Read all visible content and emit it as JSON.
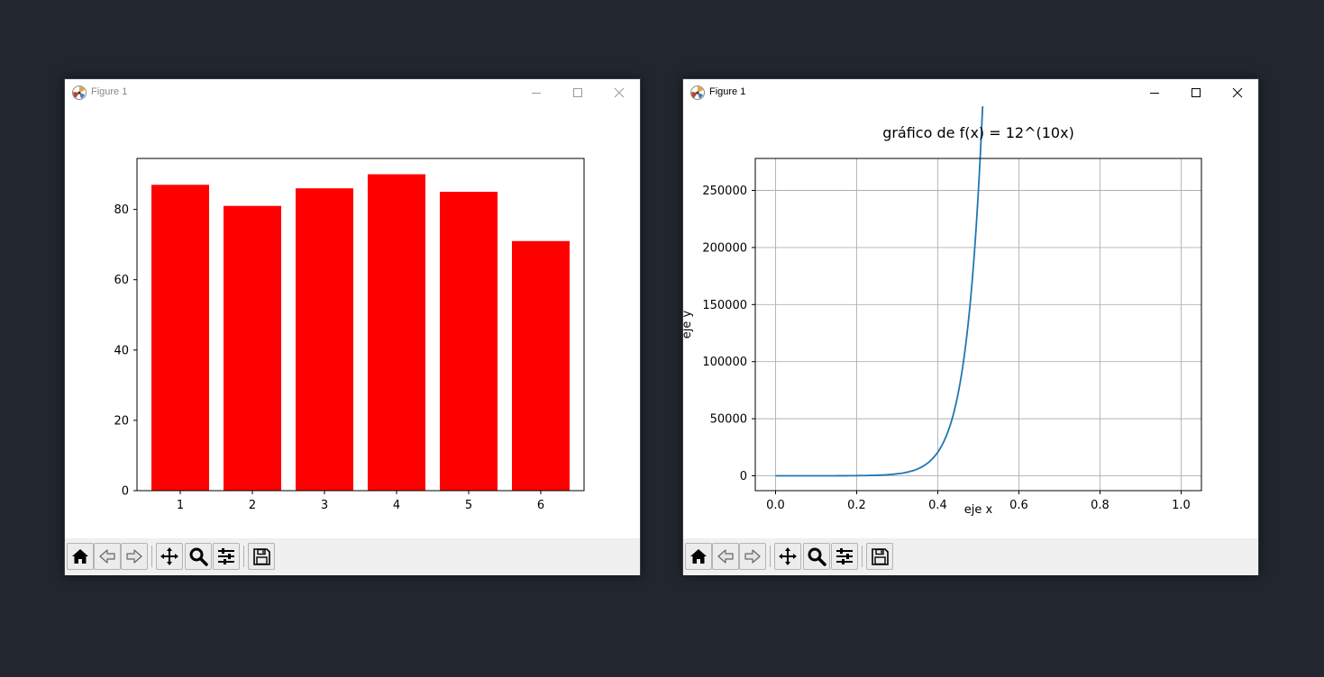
{
  "windows": [
    {
      "title": "Figure 1",
      "active": false
    },
    {
      "title": "Figure 1",
      "active": true
    }
  ],
  "toolbar_icons": [
    "home-icon",
    "back-icon",
    "forward-icon",
    "pan-icon",
    "zoom-icon",
    "configure-icon",
    "save-icon"
  ],
  "colors": {
    "desktop": "#22262e",
    "bar": "#ff0000",
    "line": "#1f77b4",
    "grid": "#b0b0b0",
    "toolbar": "#f0f0f0"
  },
  "chart_data": [
    {
      "type": "bar",
      "title": "",
      "xlabel": "",
      "ylabel": "",
      "categories": [
        "1",
        "2",
        "3",
        "4",
        "5",
        "6"
      ],
      "values": [
        87,
        81,
        86,
        90,
        85,
        71
      ],
      "ylim": [
        0,
        94.5
      ],
      "yticks": [
        0,
        20,
        40,
        60,
        80
      ],
      "ytick_labels": [
        "0",
        "20",
        "40",
        "60",
        "80"
      ],
      "grid": false
    },
    {
      "type": "line",
      "title": "gráfico de f(x) = 12^(10x)",
      "xlabel": "eje x",
      "ylabel": "eje y",
      "function": "12^(10x)",
      "x_range": [
        0,
        1
      ],
      "xlim": [
        -0.05,
        1.05
      ],
      "ylim": [
        -13000,
        278000
      ],
      "xticks": [
        0.0,
        0.2,
        0.4,
        0.6,
        0.8,
        1.0
      ],
      "xtick_labels": [
        "0.0",
        "0.2",
        "0.4",
        "0.6",
        "0.8",
        "1.0"
      ],
      "yticks": [
        0,
        50000,
        100000,
        150000,
        200000,
        250000
      ],
      "ytick_labels": [
        "0",
        "50000",
        "100000",
        "150000",
        "200000",
        "250000"
      ],
      "grid": true
    }
  ]
}
